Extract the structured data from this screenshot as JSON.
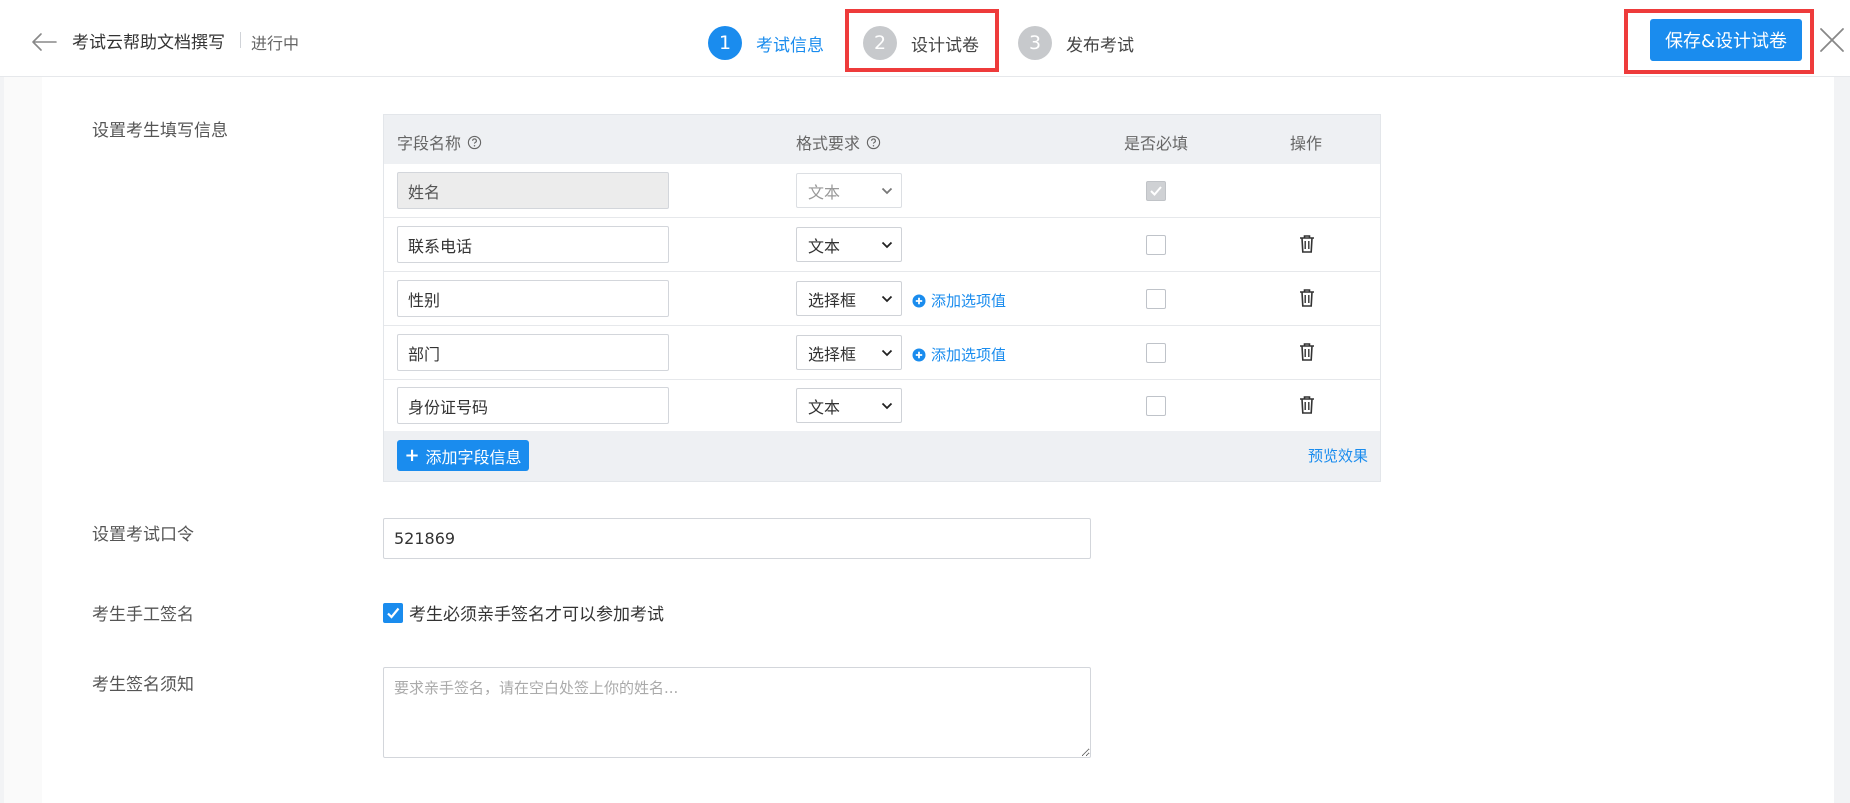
{
  "header": {
    "doc_title": "考试云帮助文档撰写",
    "status": "进行中",
    "steps": [
      {
        "number": "1",
        "label": "考试信息",
        "active": true
      },
      {
        "number": "2",
        "label": "设计试卷",
        "active": false
      },
      {
        "number": "3",
        "label": "发布考试",
        "active": false
      }
    ],
    "save_label": "保存&设计试卷"
  },
  "colors": {
    "accent": "#1a8cee",
    "highlight": "#ee3b3b"
  },
  "form": {
    "fields_label": "设置考生填写信息",
    "table": {
      "headers": {
        "name": "字段名称",
        "format": "格式要求",
        "required": "是否必填",
        "ops": "操作"
      },
      "rows": [
        {
          "name": "姓名",
          "type": "文本",
          "required": true,
          "locked": true
        },
        {
          "name": "联系电话",
          "type": "文本",
          "required": false,
          "locked": false
        },
        {
          "name": "性别",
          "type": "选择框",
          "required": false,
          "locked": false,
          "add_option": "添加选项值"
        },
        {
          "name": "部门",
          "type": "选择框",
          "required": false,
          "locked": false,
          "add_option": "添加选项值"
        },
        {
          "name": "身份证号码",
          "type": "文本",
          "required": false,
          "locked": false
        }
      ],
      "add_field_label": "添加字段信息",
      "preview_label": "预览效果"
    },
    "code_label": "设置考试口令",
    "code_value": "521869",
    "sign_label": "考生手工签名",
    "sign_checkbox_label": "考生必须亲手签名才可以参加考试",
    "sign_checked": true,
    "notice_label": "考生签名须知",
    "notice_placeholder": "要求亲手签名，请在空白处签上你的姓名..."
  }
}
